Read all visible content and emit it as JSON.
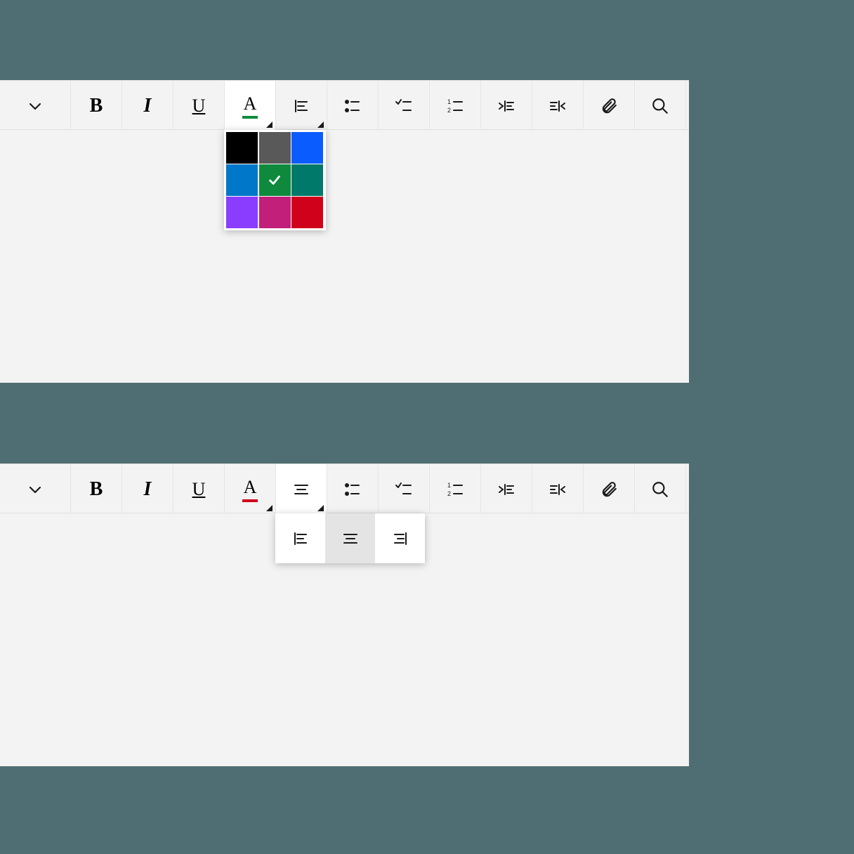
{
  "toolbar": {
    "bold_label": "B",
    "italic_label": "I",
    "underline_label": "U",
    "fontcolor_label": "A"
  },
  "colors": {
    "swatches": [
      "#000000",
      "#595959",
      "#0b5cff",
      "#0077c8",
      "#0f8a3d",
      "#00786a",
      "#8a3dff",
      "#c21f7a",
      "#d0021b"
    ],
    "selected_index": 4,
    "current_top": "#0f8a3d",
    "current_bottom": "#d0021b"
  },
  "align": {
    "options": [
      "left",
      "center",
      "right"
    ],
    "selected_top": "left",
    "selected_bottom": "center"
  }
}
